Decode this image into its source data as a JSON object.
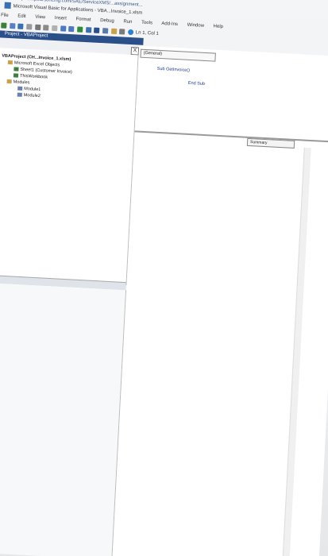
{
  "url": "https://...pearsoncmg.com/SAE/ServiceXMS/...assignment...",
  "window_title": "Microsoft Visual Basic for Applications - VBA...Invoice_1.xlsm",
  "menu": [
    "File",
    "Edit",
    "View",
    "Insert",
    "Format",
    "Debug",
    "Run",
    "Tools",
    "Add-Ins",
    "Window",
    "Help"
  ],
  "toolbar_position": "Ln 1, Col 1",
  "project_title": "Project - VBAProject",
  "close_label": "X",
  "tree": {
    "root": "VBAProject (CH...Invoice_1.xlsm)",
    "excel_objects": "Microsoft Excel Objects",
    "sheet1": "Sheet1 (Customer Invoice)",
    "workbook": "ThisWorkbook",
    "modules": "Modules",
    "module1": "Module1",
    "module2": "Module2"
  },
  "code": {
    "general": "(General)",
    "line1": "Sub  GetInvoice()",
    "line2": "End  Sub"
  },
  "summary": "Summary"
}
